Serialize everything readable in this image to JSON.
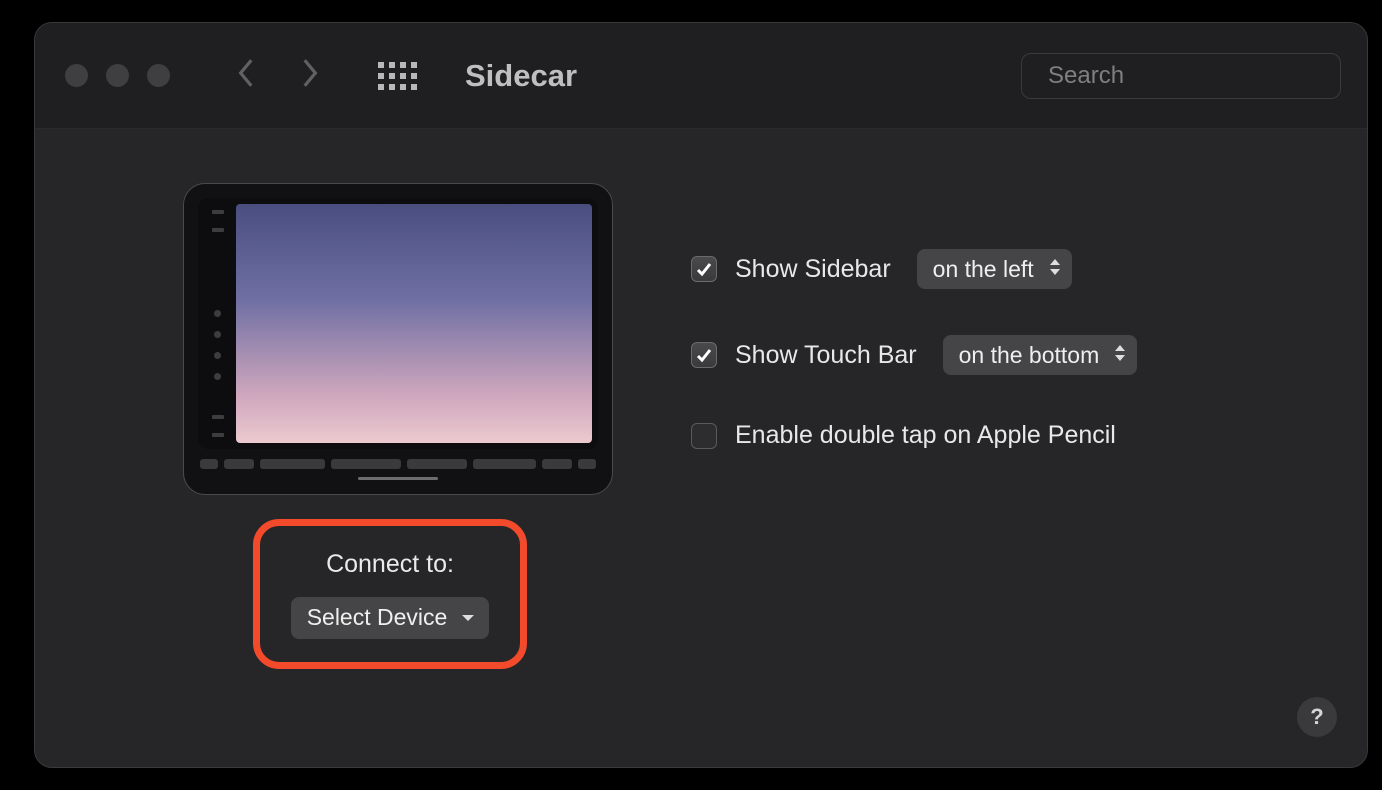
{
  "header": {
    "title": "Sidecar",
    "search_placeholder": "Search"
  },
  "connect": {
    "label": "Connect to:",
    "button": "Select Device"
  },
  "options": {
    "sidebar": {
      "label": "Show Sidebar",
      "value": "on the left",
      "checked": true
    },
    "touchbar": {
      "label": "Show Touch Bar",
      "value": "on the bottom",
      "checked": true
    },
    "pencil": {
      "label": "Enable double tap on Apple Pencil",
      "checked": false
    }
  },
  "help": "?"
}
